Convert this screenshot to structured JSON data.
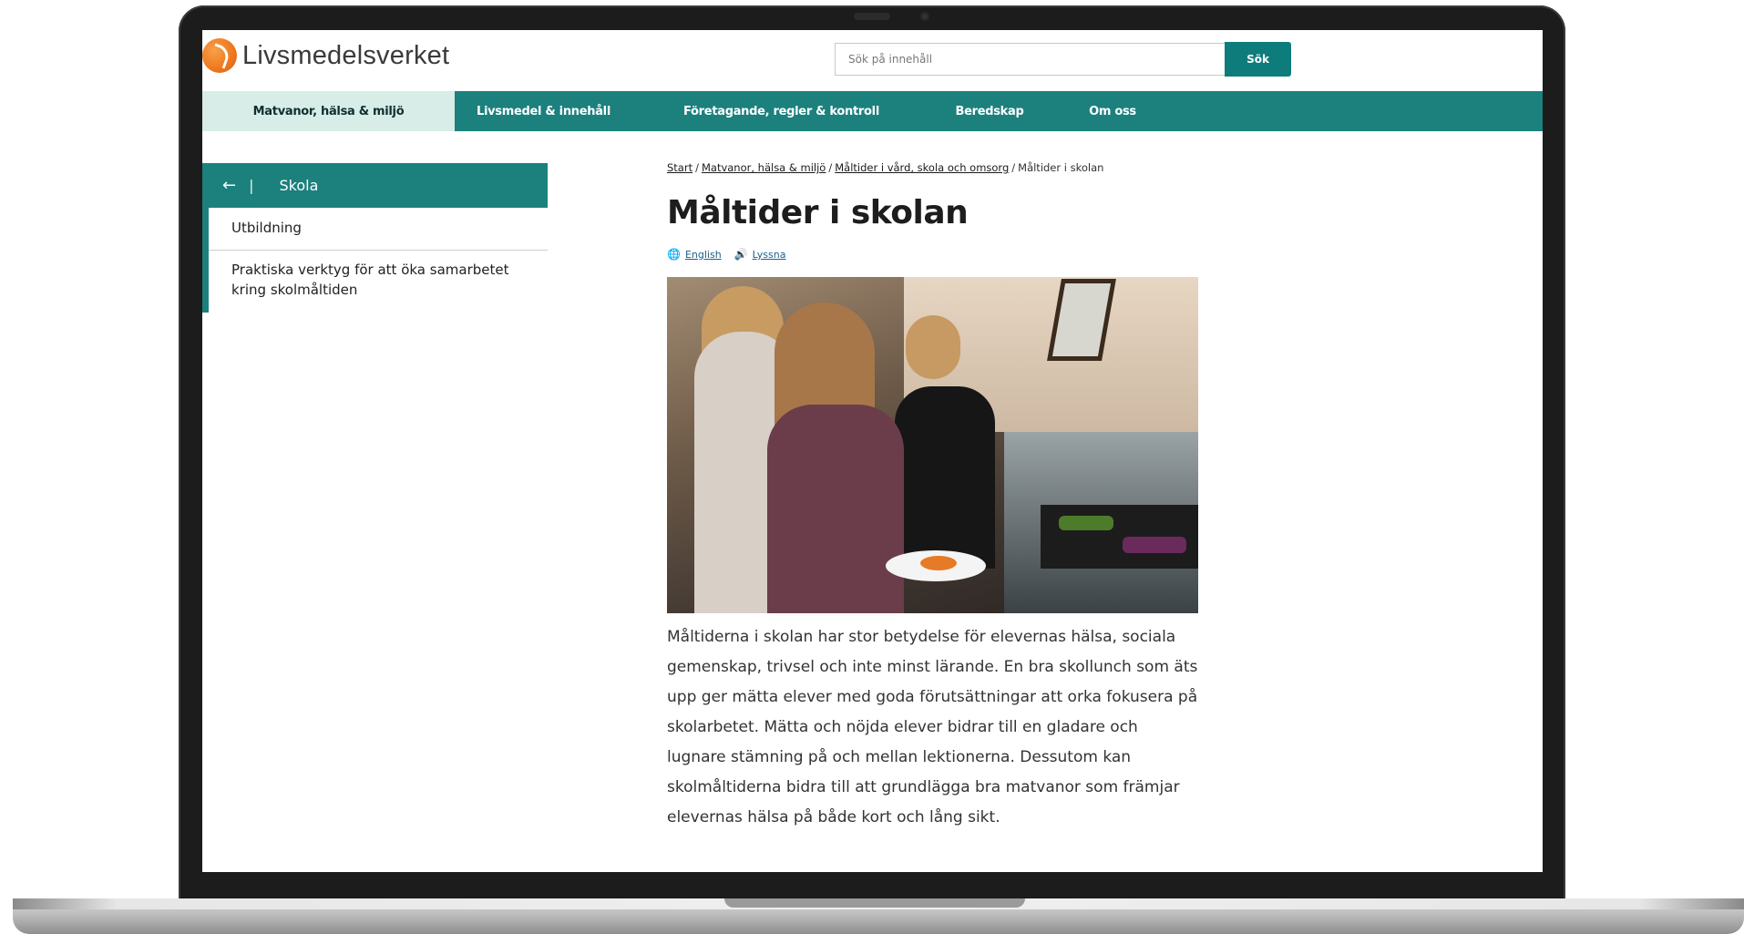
{
  "header": {
    "logo_text": "Livsmedelsverket",
    "search_placeholder": "Sök på innehåll",
    "search_button": "Sök"
  },
  "nav": {
    "items": [
      {
        "label": "Matvanor, hälsa & miljö",
        "active": true
      },
      {
        "label": "Livsmedel & innehåll",
        "active": false
      },
      {
        "label": "Företagande, regler & kontroll",
        "active": false
      },
      {
        "label": "Beredskap",
        "active": false
      },
      {
        "label": "Om oss",
        "active": false
      }
    ]
  },
  "sidebar": {
    "back_symbol": "←",
    "divider": "|",
    "title": "Skola",
    "items": [
      {
        "label": "Utbildning"
      },
      {
        "label": "Praktiska verktyg för att öka samarbetet kring skolmåltiden"
      }
    ]
  },
  "breadcrumb": {
    "items": [
      {
        "label": "Start",
        "link": true
      },
      {
        "label": "Matvanor, hälsa & miljö",
        "link": true
      },
      {
        "label": "Måltider i vård, skola och omsorg",
        "link": true
      },
      {
        "label": "Måltider i skolan",
        "link": false
      }
    ],
    "separator": "/"
  },
  "page": {
    "title": "Måltider i skolan",
    "lang_link": "English",
    "listen_link": "Lyssna",
    "body": "Måltiderna i skolan har stor betydelse för elevernas hälsa, sociala gemenskap, trivsel och inte minst lärande.  En bra skollunch som äts upp ger mätta elever med goda förutsättningar att orka fokusera på skolarbetet. Mätta och nöjda elever bidrar till en gladare och lugnare stämning på och mellan lektionerna. Dessutom kan skolmåltiderna bidra till att grundlägga bra matvanor som främjar elevernas hälsa på både kort och lång sikt."
  },
  "icons": {
    "globe": "globe-icon",
    "speaker": "speaker-icon",
    "back": "arrow-left-icon",
    "logo": "livsmedelsverket-logo-icon"
  },
  "colors": {
    "brand_teal": "#1c807d",
    "nav_active_bg": "#d8ece8",
    "logo_orange": "#ef7a1f"
  }
}
